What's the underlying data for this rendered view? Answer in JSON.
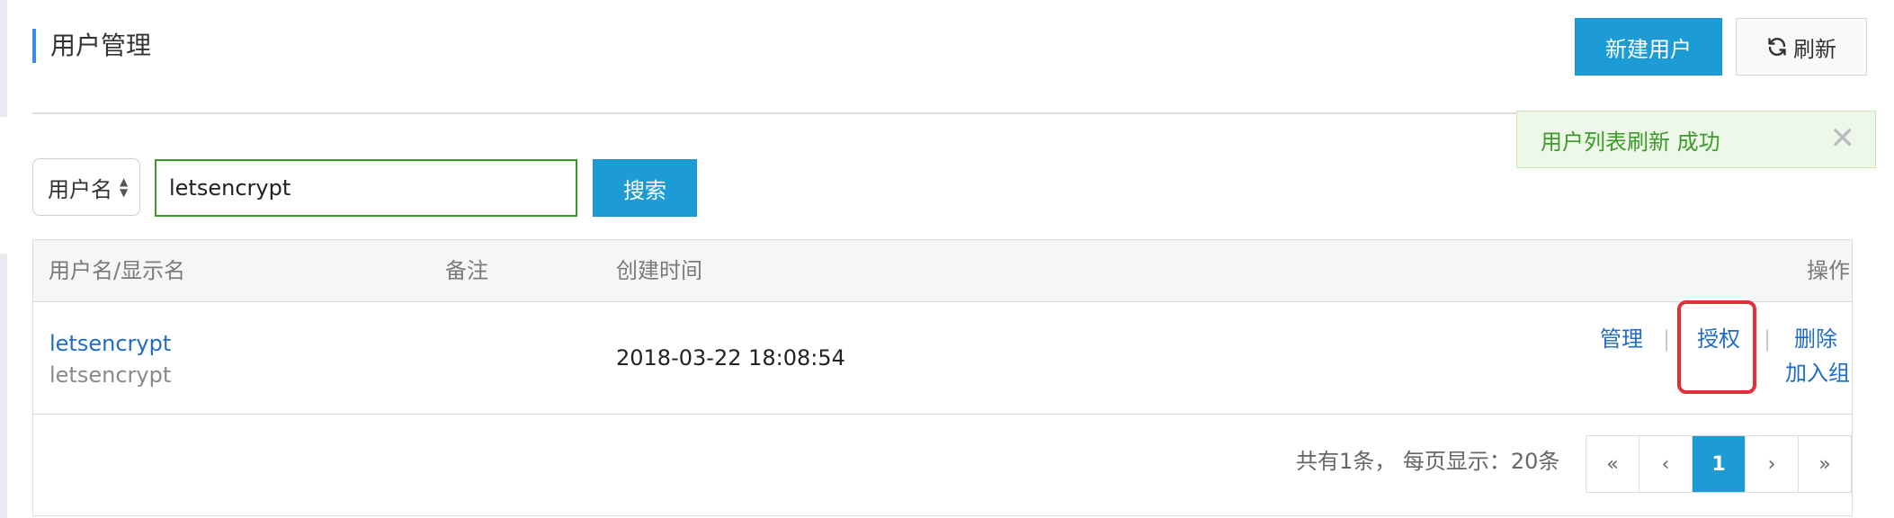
{
  "header": {
    "title": "用户管理",
    "new_user_label": "新建用户",
    "refresh_label": "刷新"
  },
  "toast": {
    "message": "用户列表刷新 成功",
    "close_symbol": "✕"
  },
  "search": {
    "field_select_value": "用户名",
    "input_value": "letsencrypt",
    "button_label": "搜索"
  },
  "table": {
    "headers": {
      "user": "用户名/显示名",
      "note": "备注",
      "created": "创建时间",
      "actions": "操作"
    },
    "rows": [
      {
        "username": "letsencrypt",
        "display_name": "letsencrypt",
        "note": "",
        "created_time": "2018-03-22 18:08:54",
        "actions": {
          "manage": "管理",
          "authorize": "授权",
          "delete": "删除",
          "add_group": "加入组",
          "separator": "|"
        }
      }
    ]
  },
  "pagination": {
    "summary": "共有1条， 每页显示：20条",
    "first": "«",
    "prev": "‹",
    "current": "1",
    "next": "›",
    "last": "»"
  },
  "colors": {
    "primary": "#1d9bd4",
    "link": "#1e6cc8",
    "success_text": "#3c9a2b",
    "highlight_border": "#e0303a"
  },
  "icons": {
    "refresh": "refresh-icon",
    "select": "sort-arrows-icon",
    "close": "close-icon"
  }
}
